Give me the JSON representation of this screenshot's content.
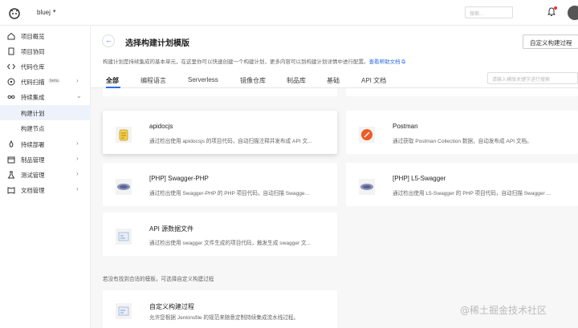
{
  "topbar": {
    "project_name": "bluej",
    "search_placeholder": "搜索..."
  },
  "sidebar": {
    "items": [
      {
        "label": "项目概览",
        "icon": "home-icon"
      },
      {
        "label": "项目协同",
        "icon": "doc-icon"
      },
      {
        "label": "代码仓库",
        "icon": "code-icon"
      },
      {
        "label": "代码扫描",
        "icon": "scan-icon",
        "badge": "beta"
      },
      {
        "label": "持续集成",
        "icon": "infinity-icon"
      },
      {
        "label": "构建计划",
        "sub": true
      },
      {
        "label": "构建节点",
        "sub": true
      },
      {
        "label": "持续部署",
        "icon": "rocket-icon"
      },
      {
        "label": "制品管理",
        "icon": "box-icon"
      },
      {
        "label": "测试管理",
        "icon": "test-icon"
      },
      {
        "label": "文档管理",
        "icon": "book-icon"
      }
    ]
  },
  "header": {
    "title": "选择构建计划模版",
    "custom_button": "自定义构建过程",
    "desc": "构建计划是持续集成的基本单元，在这里你可以快速创建一个构建计划，更多内容可以到构建计划详情中进行配置。",
    "desc_link": "查看帮助文档"
  },
  "tabs": [
    {
      "label": "全部",
      "active": true
    },
    {
      "label": "编程语言"
    },
    {
      "label": "Serverless"
    },
    {
      "label": "镜像仓库"
    },
    {
      "label": "制品库"
    },
    {
      "label": "基础"
    },
    {
      "label": "API 文档"
    }
  ],
  "tab_search_placeholder": "请输入模版关键字进行搜索",
  "cards": [
    {
      "title": "apidocjs",
      "desc": "通过检出使用 apidocsjs 的项目代码，自动扫描注释并发布成 API 文...",
      "icon": "apidocjs-icon"
    },
    {
      "title": "Postman",
      "desc": "通过获取 Postman Collection 数据，自动发布成 API 文档。",
      "icon": "postman-icon"
    },
    {
      "title": "[PHP] Swagger-PHP",
      "desc": "通过检出使用 Swagger-PHP 的 PHP 项目代码，自动扫描 Swagge...",
      "icon": "php-icon"
    },
    {
      "title": "[PHP] L5-Swagger",
      "desc": "通过检出使用 L5-Swagger 的 PHP 项目代码，自动扫描 Swagger ...",
      "icon": "php-icon"
    },
    {
      "title": "API 源数据文件",
      "desc": "通过检出使用 swagger 文件生成的项目代码，触发生成 swagger 文...",
      "icon": "file-icon"
    }
  ],
  "note": "若没有找到合适的模板，可选择自定义构建过程",
  "custom_card": {
    "title": "自定义构建过程",
    "desc": "允许您根据 Jenkinsfile 的规范来随意定制持续集成流水线过程。"
  },
  "watermark": "@稀土掘金技术社区"
}
